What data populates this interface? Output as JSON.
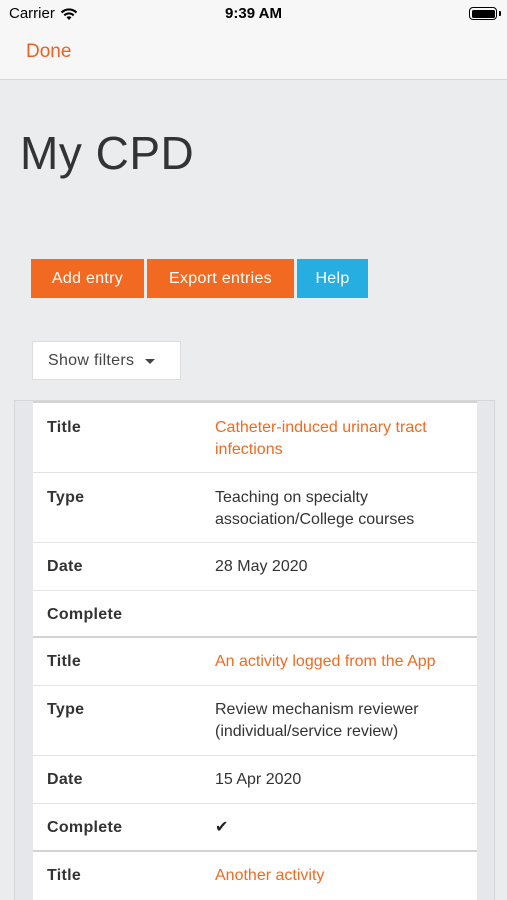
{
  "status_bar": {
    "carrier": "Carrier",
    "time": "9:39 AM"
  },
  "nav": {
    "done_label": "Done"
  },
  "page": {
    "title": "My CPD"
  },
  "actions": {
    "add_entry": "Add entry",
    "export_entries": "Export entries",
    "help": "Help"
  },
  "filters": {
    "label": "Show filters"
  },
  "labels": {
    "title": "Title",
    "type": "Type",
    "date": "Date",
    "complete": "Complete"
  },
  "entries": [
    {
      "title": "Catheter-induced urinary tract infections",
      "type": "Teaching on specialty association/College courses",
      "date": "28 May 2020",
      "complete": ""
    },
    {
      "title": "An activity logged from the App",
      "type": "Review mechanism reviewer (individual/service review)",
      "date": "15 Apr 2020",
      "complete": "✔"
    },
    {
      "title": "Another activity"
    }
  ],
  "colors": {
    "accent_orange": "#f26a21",
    "accent_blue": "#27aee1",
    "background": "#ebecee"
  }
}
